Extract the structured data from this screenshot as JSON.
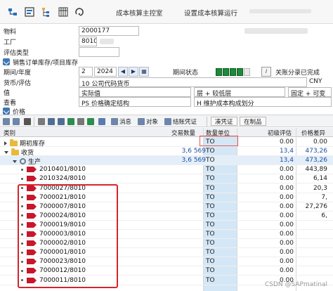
{
  "toolbar": {
    "title_main": "成本核算主控室",
    "title_settings": "设置成本核算运行",
    "icons": [
      "hierarchy-icon",
      "display-icon",
      "tree-icon",
      "grid-icon",
      "refresh-icon"
    ]
  },
  "form": {
    "material_label": "物料",
    "material_value": "2000177",
    "plant_label": "工厂",
    "plant_value": "8010",
    "valuation_type_label": "评估类型",
    "sales_order_label": "销售订单库存/项目库存",
    "period_label": "期间/年度",
    "period_value": "2",
    "year_value": "2024",
    "period_status_label": "期间状态",
    "close_label": "关账分录已完成",
    "currency_label": "货币/评估",
    "currency_value": "10 公司代码货币",
    "currency_code": "CNY",
    "value_label": "值",
    "value_value": "实际值",
    "layer_value": "层 + 较低层",
    "fixed_value": "固定 + 可变",
    "view_label": "查看",
    "view_value": "PS 价格确定结构",
    "maintain_value": "H 维护成本构成划分",
    "price_label": "价格"
  },
  "alv": {
    "btn_message": "消息",
    "btn_object": "对象",
    "btn_settlement": "结账凭证",
    "btn_voucher": "凑凭证",
    "btn_wip": "在制品"
  },
  "grid": {
    "headers": {
      "category": "类别",
      "qty": "交易数量",
      "unit": "数量单位",
      "initial": "初级评估",
      "price_diff": "价格差异"
    },
    "rows": [
      {
        "name": "期初库存",
        "qty": "",
        "unit": "TO",
        "cost": "0.00",
        "diff": "0.00",
        "kind": "folder",
        "indent": 1
      },
      {
        "name": "收货",
        "qty": "3,6 569",
        "unit": "TO",
        "cost": "13,4",
        "diff": "473,26",
        "kind": "folder-open",
        "indent": 1,
        "blue": true
      },
      {
        "name": "生产",
        "qty": "3,6 569",
        "unit": "TO",
        "cost": "13,4",
        "diff": "473,26",
        "kind": "gear",
        "indent": 2,
        "blue": true,
        "hl": true
      },
      {
        "name": "2010401/8010",
        "qty": "",
        "unit": "TO",
        "cost": "0.00",
        "diff": "443,89",
        "kind": "order",
        "indent": 3
      },
      {
        "name": "2010324/8010",
        "qty": "",
        "unit": "TO",
        "cost": "0.00",
        "diff": "6,14",
        "kind": "order",
        "indent": 3
      },
      {
        "name": "7000027/8010",
        "qty": "",
        "unit": "TO",
        "cost": "0.00",
        "diff": "20,3",
        "kind": "order",
        "indent": 3
      },
      {
        "name": "7000021/8010",
        "qty": "",
        "unit": "TO",
        "cost": "0.00",
        "diff": "7,",
        "kind": "order",
        "indent": 3
      },
      {
        "name": "7000007/8010",
        "qty": "",
        "unit": "TO",
        "cost": "0.00",
        "diff": "27,276",
        "kind": "order",
        "indent": 3
      },
      {
        "name": "7000024/8010",
        "qty": "",
        "unit": "TO",
        "cost": "0.00",
        "diff": "6,",
        "kind": "order",
        "indent": 3
      },
      {
        "name": "7000019/8010",
        "qty": "",
        "unit": "TO",
        "cost": "0.00",
        "diff": "",
        "kind": "order",
        "indent": 3
      },
      {
        "name": "7000003/8010",
        "qty": "",
        "unit": "TO",
        "cost": "0.00",
        "diff": "",
        "kind": "order",
        "indent": 3
      },
      {
        "name": "7000002/8010",
        "qty": "",
        "unit": "TO",
        "cost": "0.00",
        "diff": "",
        "kind": "order",
        "indent": 3
      },
      {
        "name": "7000001/8010",
        "qty": "",
        "unit": "TO",
        "cost": "0.00",
        "diff": "",
        "kind": "order",
        "indent": 3
      },
      {
        "name": "7000023/8010",
        "qty": "",
        "unit": "TO",
        "cost": "0.00",
        "diff": "",
        "kind": "order",
        "indent": 3
      },
      {
        "name": "7000012/8010",
        "qty": "",
        "unit": "TO",
        "cost": "0.00",
        "diff": "",
        "kind": "order",
        "indent": 3
      },
      {
        "name": "7000011/8010",
        "qty": "",
        "unit": "TO",
        "cost": "0.00",
        "diff": "",
        "kind": "order",
        "indent": 3
      }
    ]
  },
  "watermark": "CSDN @SAPmatinal",
  "colors": {
    "accent_red": "#c8172b",
    "status_green": "#1e8a3a",
    "unit_column": "#d4e7f6"
  }
}
